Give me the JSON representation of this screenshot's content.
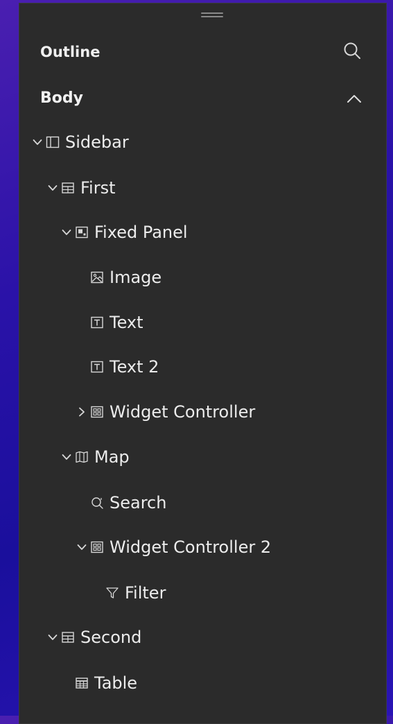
{
  "panel": {
    "title": "Outline",
    "section_title": "Body"
  },
  "tree": [
    {
      "label": "Sidebar",
      "icon": "sidebar-icon",
      "state": "expanded"
    },
    {
      "label": "First",
      "icon": "column-layout-icon",
      "state": "expanded"
    },
    {
      "label": "Fixed Panel",
      "icon": "fixed-panel-icon",
      "state": "expanded"
    },
    {
      "label": "Image",
      "icon": "image-icon",
      "state": "leaf"
    },
    {
      "label": "Text",
      "icon": "text-icon",
      "state": "leaf"
    },
    {
      "label": "Text 2",
      "icon": "text-icon",
      "state": "leaf"
    },
    {
      "label": "Widget Controller",
      "icon": "widget-controller-icon",
      "state": "collapsed"
    },
    {
      "label": "Map",
      "icon": "map-icon",
      "state": "expanded"
    },
    {
      "label": "Search",
      "icon": "search-icon",
      "state": "leaf"
    },
    {
      "label": "Widget Controller 2",
      "icon": "widget-controller-icon",
      "state": "expanded"
    },
    {
      "label": "Filter",
      "icon": "filter-icon",
      "state": "leaf"
    },
    {
      "label": "Second",
      "icon": "column-layout-icon",
      "state": "expanded"
    },
    {
      "label": "Table",
      "icon": "table-icon",
      "state": "leaf"
    }
  ]
}
